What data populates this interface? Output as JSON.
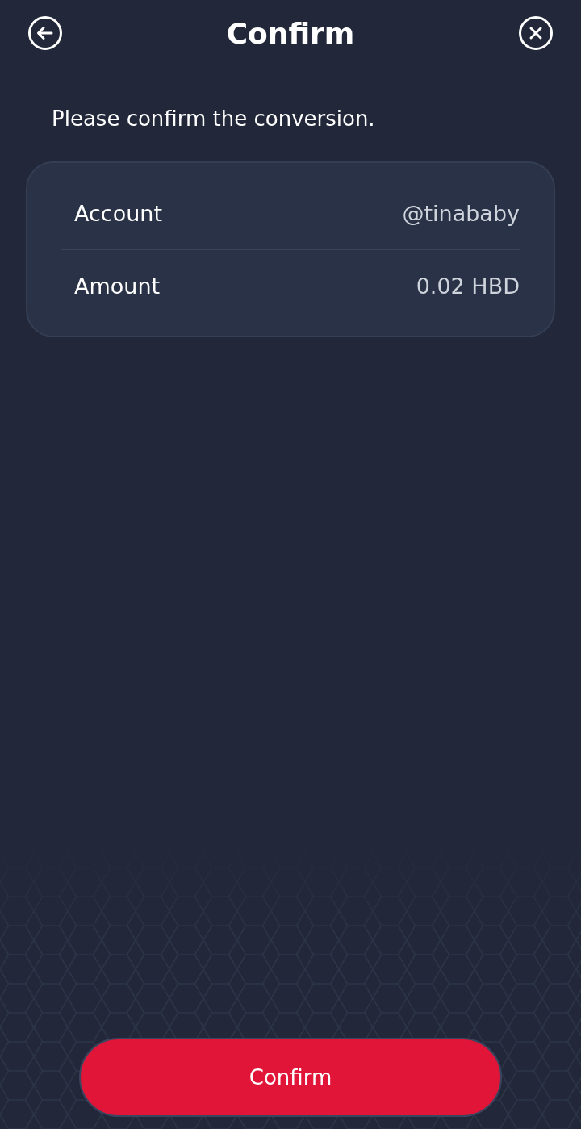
{
  "header": {
    "title": "Confirm"
  },
  "message": "Please confirm the conversion.",
  "details": [
    {
      "label": "Account",
      "value": "@tinababy"
    },
    {
      "label": "Amount",
      "value": "0.02 HBD"
    }
  ],
  "confirm_button": {
    "label": "Confirm"
  }
}
